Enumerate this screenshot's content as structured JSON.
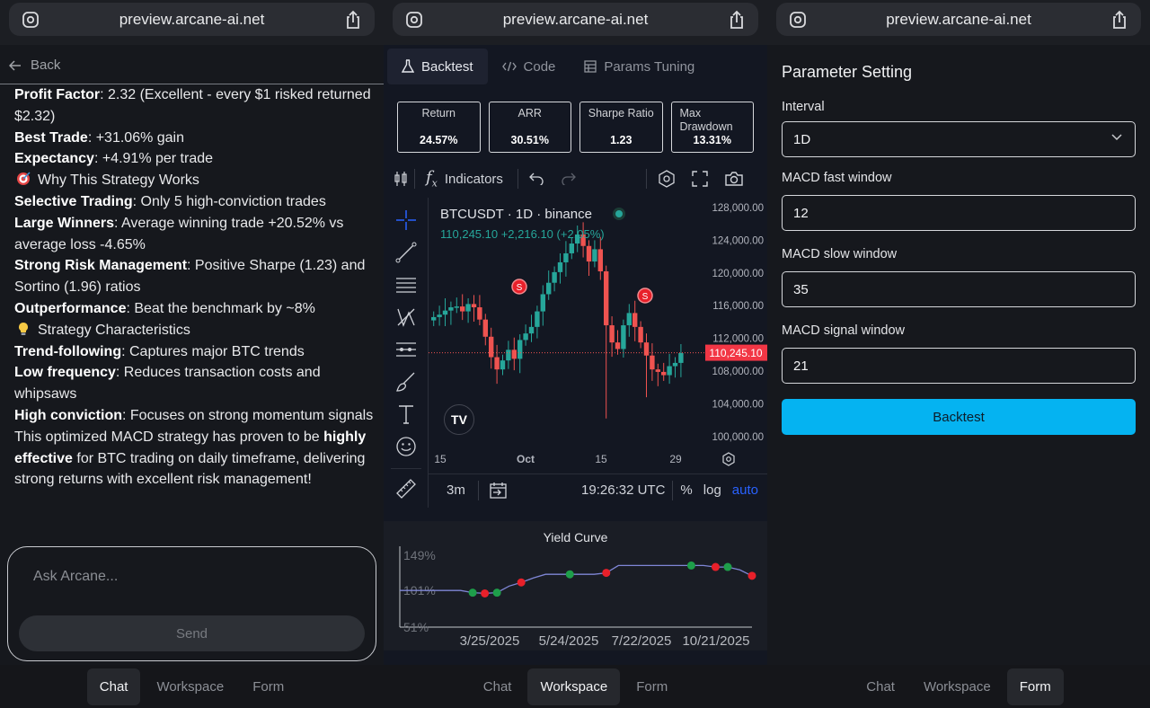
{
  "browser": {
    "url": "preview.arcane-ai.net"
  },
  "nav": {
    "tabs": [
      "Chat",
      "Workspace",
      "Form"
    ]
  },
  "chat": {
    "back_label": "Back",
    "lines": [
      {
        "b": "Profit Factor",
        "t": ": 2.32 (Excellent - every $1 risked returned $2.32)"
      },
      {
        "b": "Best Trade",
        "t": ": +31.06% gain"
      },
      {
        "b": "Expectancy",
        "t": ": +4.91% per trade"
      },
      {
        "emoji": "target-icon",
        "t": "Why This Strategy Works"
      },
      {
        "b": "Selective Trading",
        "t": ": Only 5 high-conviction trades"
      },
      {
        "b": "Large Winners",
        "t": ": Average winning trade +20.52% vs average loss -4.65%"
      },
      {
        "b": "Strong Risk Management",
        "t": ": Positive Sharpe (1.23) and Sortino (1.96) ratios"
      },
      {
        "b": "Outperformance",
        "t": ": Beat the benchmark by ~8%"
      },
      {
        "emoji": "lightbulb-icon",
        "t": "Strategy Characteristics"
      },
      {
        "b": "Trend-following",
        "t": ": Captures major BTC trends"
      },
      {
        "b": "Low frequency",
        "t": ": Reduces transaction costs and whipsaws"
      },
      {
        "b": "High conviction",
        "t": ": Focuses on strong momentum signals"
      }
    ],
    "closing": {
      "pre": "This optimized MACD strategy has proven to be ",
      "b1": "highly effective",
      "post": " for BTC trading on daily timeframe, delivering strong returns with excellent risk management!"
    },
    "input_placeholder": "Ask Arcane...",
    "send_label": "Send"
  },
  "workspace": {
    "tabs": [
      {
        "label": "Backtest",
        "icon": "flask-icon"
      },
      {
        "label": "Code",
        "icon": "code-icon"
      },
      {
        "label": "Params Tuning",
        "icon": "grid-icon"
      }
    ],
    "metrics": [
      {
        "label": "Return",
        "value": "24.57%"
      },
      {
        "label": "ARR",
        "value": "30.51%"
      },
      {
        "label": "Sharpe Ratio",
        "value": "1.23"
      },
      {
        "label": "Max Drawdown",
        "value": "13.31%"
      }
    ],
    "toolbar": {
      "indicators": "Indicators"
    },
    "chart": {
      "symbol": "BTCUSDT · 1D · binance",
      "quote": "110,245.10  +2,216.10 (+2.05%)",
      "price_tag": "110,245.10",
      "y_ticks": [
        "128,000.00",
        "124,000.00",
        "120,000.00",
        "116,000.00",
        "112,000.00",
        "108,000.00",
        "104,000.00",
        "100,000.00"
      ],
      "x_ticks": [
        "15",
        "Oct",
        "15",
        "29"
      ],
      "range": "3m",
      "time": "19:26:32 UTC",
      "pct": "%",
      "log": "log",
      "auto": "auto",
      "sell_marker": "S",
      "tv_logo": "TV"
    },
    "yield_curve": {
      "title": "Yield Curve",
      "y_ticks": [
        "149%",
        "101%",
        "51%"
      ],
      "x_ticks": [
        "3/25/2025",
        "5/24/2025",
        "7/22/2025",
        "10/21/2025"
      ]
    }
  },
  "chart_data": {
    "type": "line",
    "title": "Yield Curve",
    "ylim": [
      51,
      149
    ],
    "series": [
      {
        "values": [
          101,
          101,
          101,
          101,
          101,
          101,
          98,
          97,
          98,
          107,
          112,
          118,
          123,
          123,
          123,
          123,
          123,
          125,
          135,
          135,
          135,
          135,
          135,
          135,
          135,
          135,
          133,
          133,
          129,
          121
        ]
      }
    ]
  },
  "form": {
    "title": "Parameter Setting",
    "fields": [
      {
        "label": "Interval",
        "value": "1D"
      },
      {
        "label": "MACD fast window",
        "value": "12"
      },
      {
        "label": "MACD slow window",
        "value": "35"
      },
      {
        "label": "MACD signal window",
        "value": "21"
      }
    ],
    "submit": "Backtest"
  },
  "colors": {
    "accent": "#05b3f1",
    "up": "#26a69a",
    "down": "#ef5350",
    "buy_marker": "#1e9e4a",
    "sell_marker": "#e8202a"
  }
}
